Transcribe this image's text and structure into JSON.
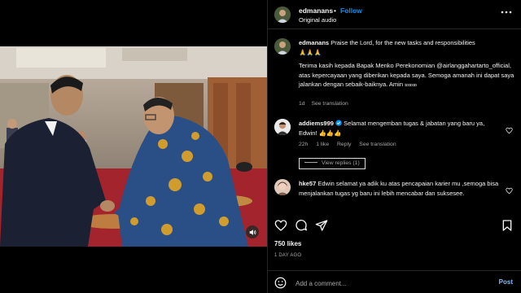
{
  "post": {
    "username": "edmanans",
    "separator": "•",
    "follow_label": "Follow",
    "audio": "Original audio",
    "likes": "750 likes",
    "age": "1 DAY AGO"
  },
  "caption": {
    "username": "edmanans",
    "line1": "Praise the Lord, for the new tasks and responsibilities",
    "emoji": "🙏🙏🙏",
    "body": "Terima kasih kepada Bapak Menko Perekonomian @airlanggahartarto_official, atas kepercayaan yang diberikan kepada saya. Semoga amanah ini dapat saya jalankan dengan sebaik-baiknya. Amin",
    "suffix": "ɪᴅɪᴅɪᴅ",
    "time": "1d",
    "see_translation": "See translation"
  },
  "comments": [
    {
      "username": "addiems999",
      "text": "Selamat mengemban tugas & jabatan yang baru ya, Edwin! 👍👍👍",
      "time": "22h",
      "likes": "1 like",
      "reply": "Reply",
      "see_translation": "See translation",
      "view_replies": "View replies (1)"
    },
    {
      "username": "hke57",
      "text": "Edwin selamat ya adik ku atas pencapaian karier mu ,semoga bisa menjalankan tugas yg baru ini lebih mencabar dan suksesee."
    }
  ],
  "composer": {
    "placeholder": "Add a comment...",
    "post_label": "Post"
  },
  "colors": {
    "accent": "#0095f6",
    "verified": "#0095f6",
    "background": "#000000",
    "divider": "#262626"
  }
}
